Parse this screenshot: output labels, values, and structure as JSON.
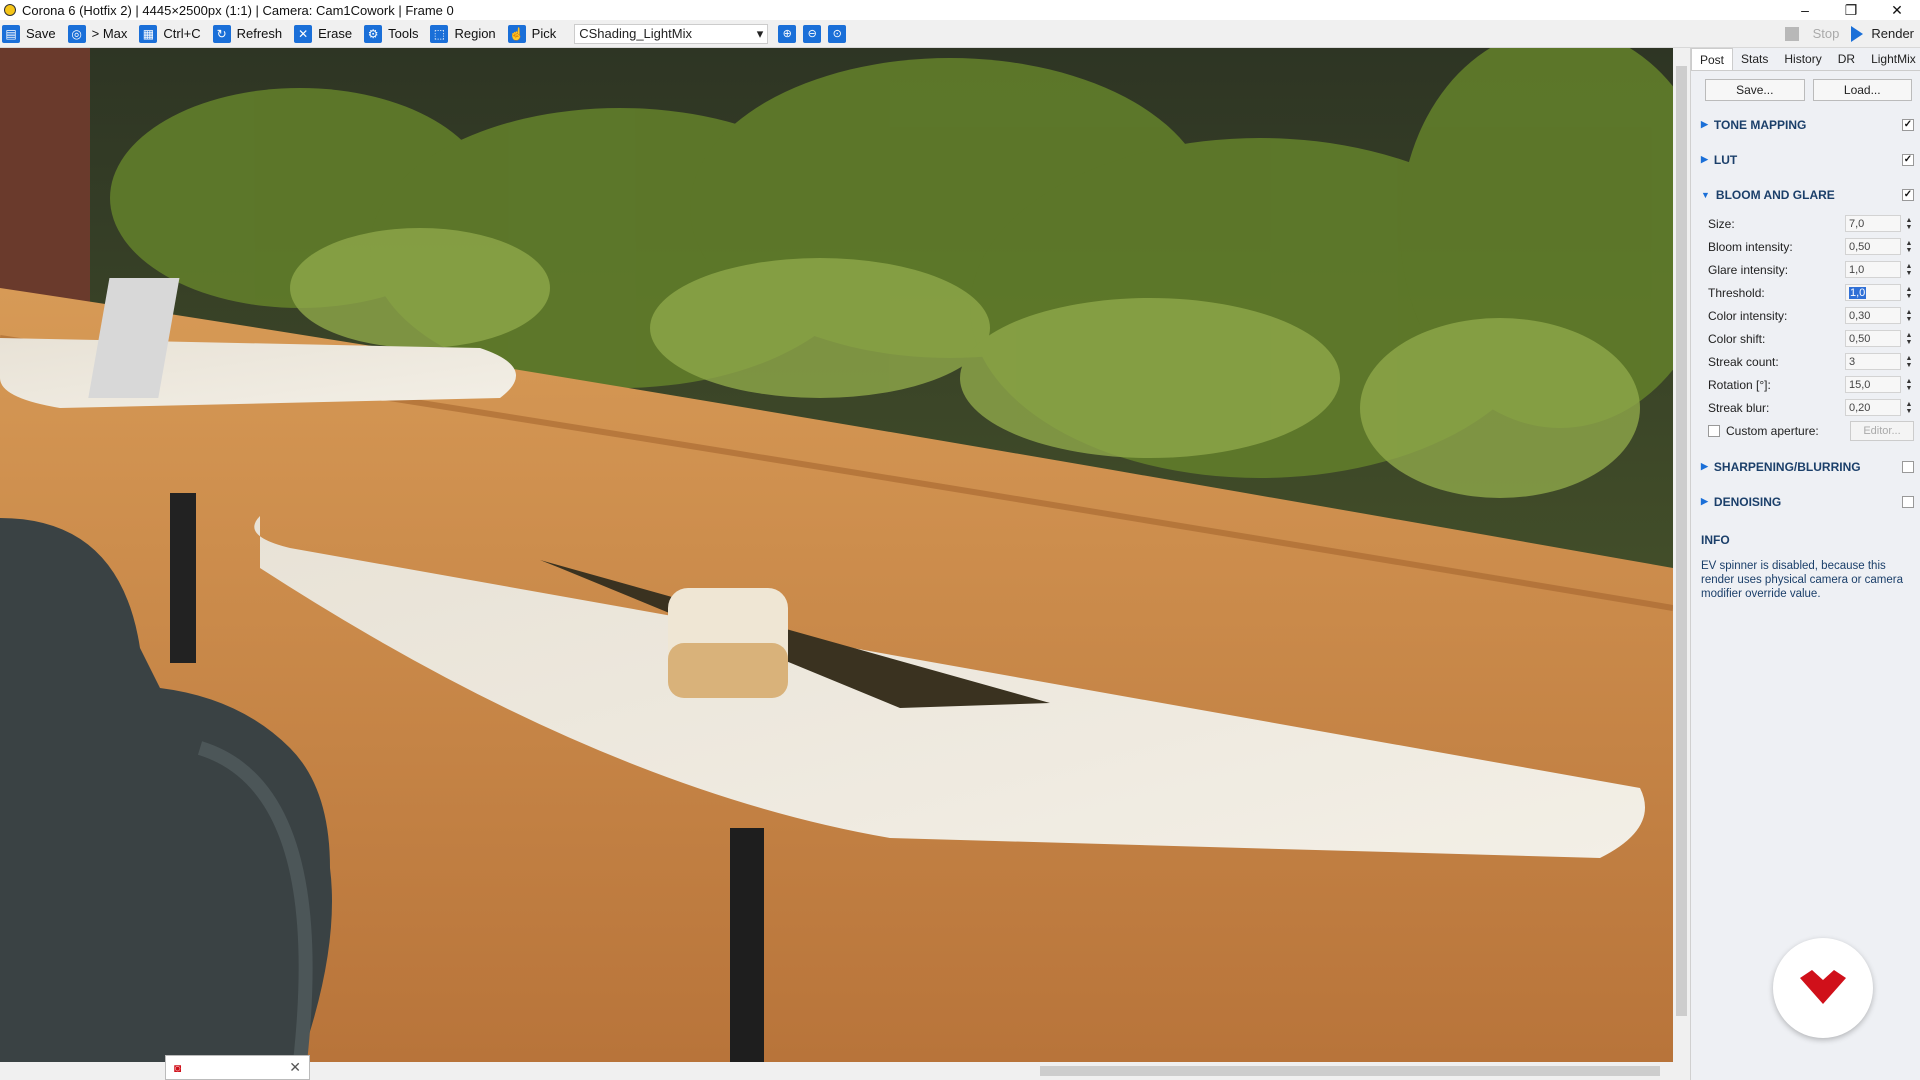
{
  "window": {
    "title": "Corona 6 (Hotfix 2) | 4445×2500px (1:1) | Camera: Cam1Cowork | Frame 0",
    "minimize": "–",
    "maximize": "❐",
    "close": "✕"
  },
  "toolbar": {
    "save": "Save",
    "max": "> Max",
    "copy": "Ctrl+C",
    "refresh": "Refresh",
    "erase": "Erase",
    "tools": "Tools",
    "region": "Region",
    "pick": "Pick",
    "lightmix_value": "CShading_LightMix",
    "stop": "Stop",
    "render": "Render"
  },
  "panel": {
    "tabs": [
      "Post",
      "Stats",
      "History",
      "DR",
      "LightMix"
    ],
    "save_btn": "Save...",
    "load_btn": "Load...",
    "sections": {
      "tone_mapping": "TONE MAPPING",
      "lut": "LUT",
      "bloom": "BLOOM AND GLARE",
      "sharpen": "SHARPENING/BLURRING",
      "denoise": "DENOISING"
    },
    "params": [
      {
        "label": "Size:",
        "value": "7,0"
      },
      {
        "label": "Bloom intensity:",
        "value": "0,50"
      },
      {
        "label": "Glare intensity:",
        "value": "1,0"
      },
      {
        "label": "Threshold:",
        "value": "1,0"
      },
      {
        "label": "Color intensity:",
        "value": "0,30"
      },
      {
        "label": "Color shift:",
        "value": "0,50"
      },
      {
        "label": "Streak count:",
        "value": "3"
      },
      {
        "label": "Rotation [°]:",
        "value": "15,0"
      },
      {
        "label": "Streak blur:",
        "value": "0,20"
      }
    ],
    "custom_aperture": "Custom aperture:",
    "editor": "Editor...",
    "info_title": "INFO",
    "info_text": "EV spinner is disabled, because this render uses physical camera or camera modifier override value."
  },
  "colors": {
    "accent": "#1a6fd8",
    "sofa": "#c98a4a",
    "logo_red": "#d0101a"
  }
}
